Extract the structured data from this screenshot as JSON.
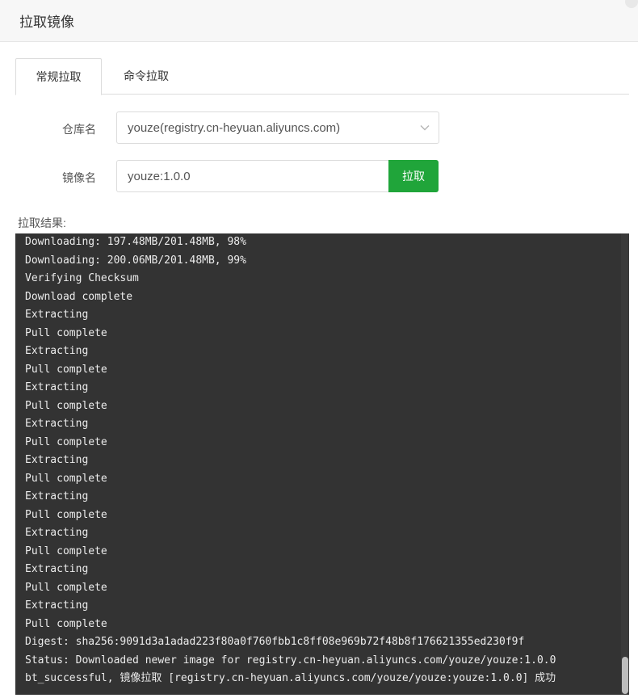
{
  "header": {
    "title": "拉取镜像"
  },
  "tabs": [
    {
      "label": "常规拉取",
      "active": true
    },
    {
      "label": "命令拉取",
      "active": false
    }
  ],
  "form": {
    "repo_label": "仓库名",
    "repo_value": "youze(registry.cn-heyuan.aliyuncs.com)",
    "image_label": "镜像名",
    "image_value": "youze:1.0.0",
    "pull_button": "拉取"
  },
  "result_label": "拉取结果:",
  "console": {
    "lines": [
      "Downloading: 197.48MB/201.48MB, 98%",
      "Downloading: 200.06MB/201.48MB, 99%",
      "Verifying Checksum",
      "Download complete",
      "Extracting",
      "Pull complete",
      "Extracting",
      "Pull complete",
      "Extracting",
      "Pull complete",
      "Extracting",
      "Pull complete",
      "Extracting",
      "Pull complete",
      "Extracting",
      "Pull complete",
      "Extracting",
      "Pull complete",
      "Extracting",
      "Pull complete",
      "Extracting",
      "Pull complete",
      "Digest: sha256:9091d3a1adad223f80a0f760fbb1c8ff08e969b72f48b8f176621355ed230f9f",
      "Status: Downloaded newer image for registry.cn-heyuan.aliyuncs.com/youze/youze:1.0.0",
      "bt_successful, 镜像拉取 [registry.cn-heyuan.aliyuncs.com/youze/youze:youze:1.0.0] 成功"
    ]
  },
  "colors": {
    "accent": "#20a53a",
    "console_bg": "#333333",
    "console_text": "#ececec"
  },
  "icons": {
    "select_arrow": "chevron-down-icon"
  }
}
